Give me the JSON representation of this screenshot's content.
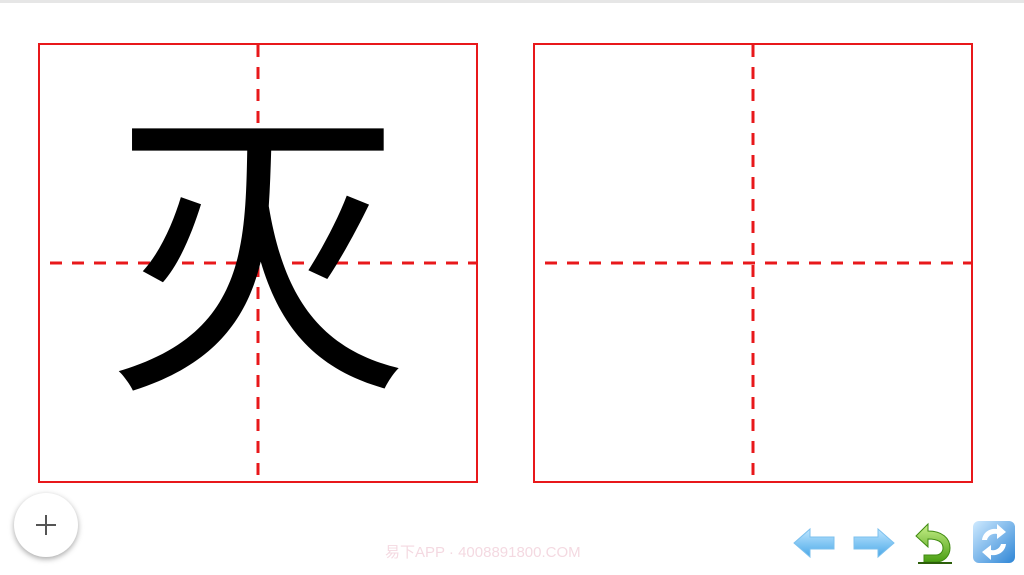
{
  "practice": {
    "character": "灭",
    "grid_color": "#e8181b",
    "grids": [
      {
        "role": "example",
        "content": "灭"
      },
      {
        "role": "blank",
        "content": ""
      }
    ]
  },
  "watermark": "易下APP · 4008891800.COM",
  "controls": {
    "add": "plus-icon",
    "back": "arrow-left-icon",
    "forward": "arrow-right-icon",
    "undo": "undo-icon",
    "refresh": "refresh-icon"
  }
}
